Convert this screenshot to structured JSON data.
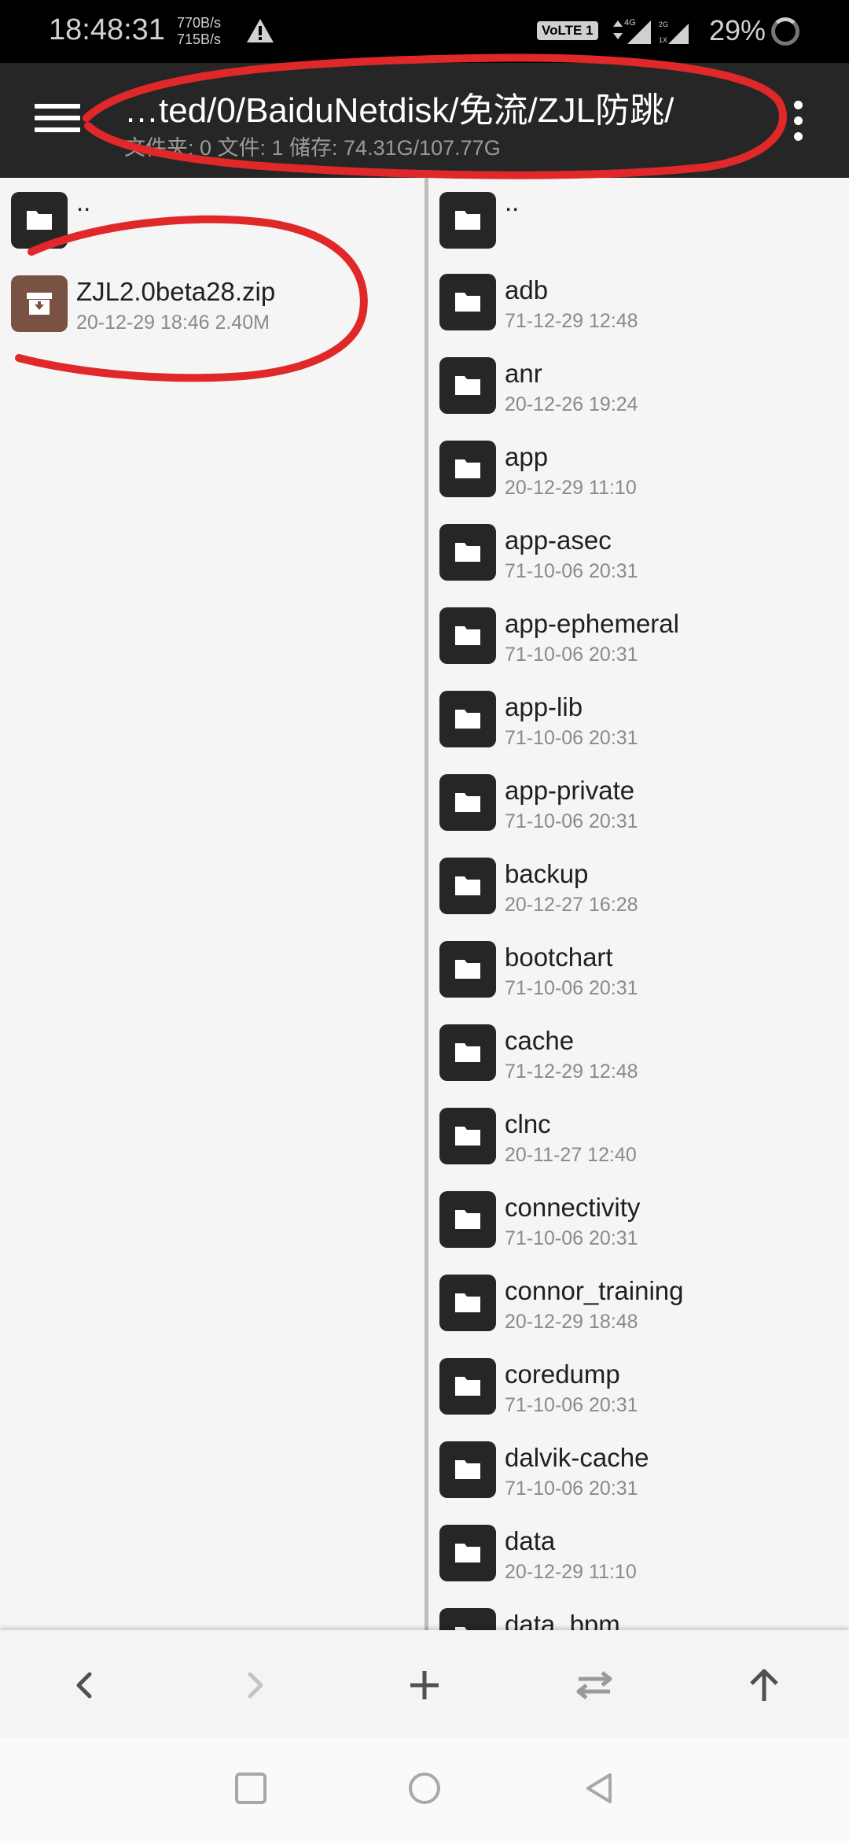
{
  "status_bar": {
    "time": "18:48:31",
    "speed_up": "770B/s",
    "speed_down": "715B/s",
    "volte": "VoLTE 1",
    "net_4g": "4G",
    "net_2g": "2G",
    "net_1x": "1X",
    "battery": "29%"
  },
  "toolbar": {
    "path": "…ted/0/BaiduNetdisk/免流/ZJL防跳/",
    "summary": "文件夹: 0  文件: 1  储存: 74.31G/107.77G"
  },
  "left_pane": {
    "items": [
      {
        "name": "..",
        "meta": "",
        "type": "folder"
      },
      {
        "name": "ZJL2.0beta28.zip",
        "meta": "20-12-29 18:46  2.40M",
        "type": "zip"
      }
    ]
  },
  "right_pane": {
    "items": [
      {
        "name": "..",
        "meta": ""
      },
      {
        "name": "adb",
        "meta": "71-12-29 12:48"
      },
      {
        "name": "anr",
        "meta": "20-12-26 19:24"
      },
      {
        "name": "app",
        "meta": "20-12-29 11:10"
      },
      {
        "name": "app-asec",
        "meta": "71-10-06 20:31"
      },
      {
        "name": "app-ephemeral",
        "meta": "71-10-06 20:31"
      },
      {
        "name": "app-lib",
        "meta": "71-10-06 20:31"
      },
      {
        "name": "app-private",
        "meta": "71-10-06 20:31"
      },
      {
        "name": "backup",
        "meta": "20-12-27 16:28"
      },
      {
        "name": "bootchart",
        "meta": "71-10-06 20:31"
      },
      {
        "name": "cache",
        "meta": "71-12-29 12:48"
      },
      {
        "name": "clnc",
        "meta": "20-11-27 12:40"
      },
      {
        "name": "connectivity",
        "meta": "71-10-06 20:31"
      },
      {
        "name": "connor_training",
        "meta": "20-12-29 18:48"
      },
      {
        "name": "coredump",
        "meta": "71-10-06 20:31"
      },
      {
        "name": "dalvik-cache",
        "meta": "71-10-06 20:31"
      },
      {
        "name": "data",
        "meta": "20-12-29 11:10"
      },
      {
        "name": "data_bpm",
        "meta": ""
      }
    ]
  },
  "action_bar": {
    "icons": [
      "back-arrow-icon",
      "forward-arrow-icon",
      "add-icon",
      "swap-icon",
      "up-arrow-icon"
    ]
  },
  "nav_bar": {
    "icons": [
      "recents-square-icon",
      "home-circle-icon",
      "back-triangle-icon"
    ]
  },
  "colors": {
    "toolbar_bg": "#262626",
    "folder_icon_bg": "#262626",
    "zip_icon_bg": "#7a5244",
    "annotation_red": "#e0282a"
  }
}
